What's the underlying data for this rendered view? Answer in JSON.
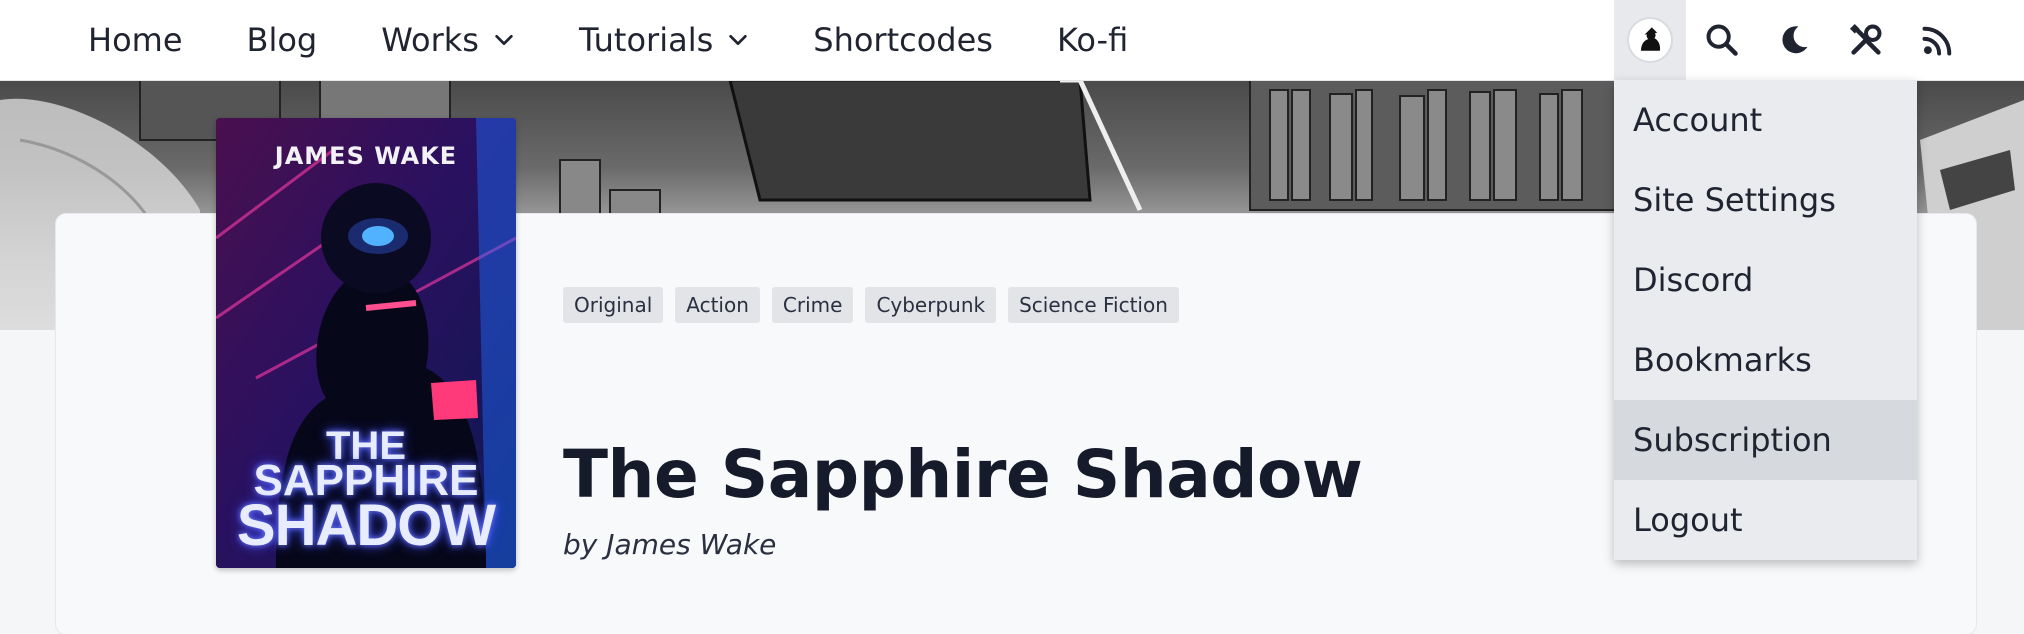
{
  "nav": {
    "items": [
      {
        "label": "Home",
        "has_dropdown": false
      },
      {
        "label": "Blog",
        "has_dropdown": false
      },
      {
        "label": "Works",
        "has_dropdown": true
      },
      {
        "label": "Tutorials",
        "has_dropdown": true
      },
      {
        "label": "Shortcodes",
        "has_dropdown": false
      },
      {
        "label": "Ko-fi",
        "has_dropdown": false
      }
    ],
    "tools": [
      "user-avatar",
      "search-icon",
      "moon-icon",
      "tools-icon",
      "rss-icon"
    ]
  },
  "user_menu": {
    "items": [
      {
        "label": "Account"
      },
      {
        "label": "Site Settings"
      },
      {
        "label": "Discord"
      },
      {
        "label": "Bookmarks"
      },
      {
        "label": "Subscription",
        "hovered": true
      },
      {
        "label": "Logout"
      }
    ]
  },
  "book": {
    "cover": {
      "author": "JAMES WAKE",
      "title_lines": [
        "THE",
        "SAPPHIRE",
        "SHADOW"
      ]
    },
    "tags": [
      "Original",
      "Action",
      "Crime",
      "Cyberpunk",
      "Science Fiction"
    ],
    "title": "The Sapphire Shadow",
    "byline": "by James Wake"
  },
  "colors": {
    "nav_bg": "#ffffff",
    "text": "#1f2430",
    "tag_bg": "#e2e4e8",
    "menu_bg": "#e9ebee",
    "menu_hover": "#d6d9de"
  }
}
